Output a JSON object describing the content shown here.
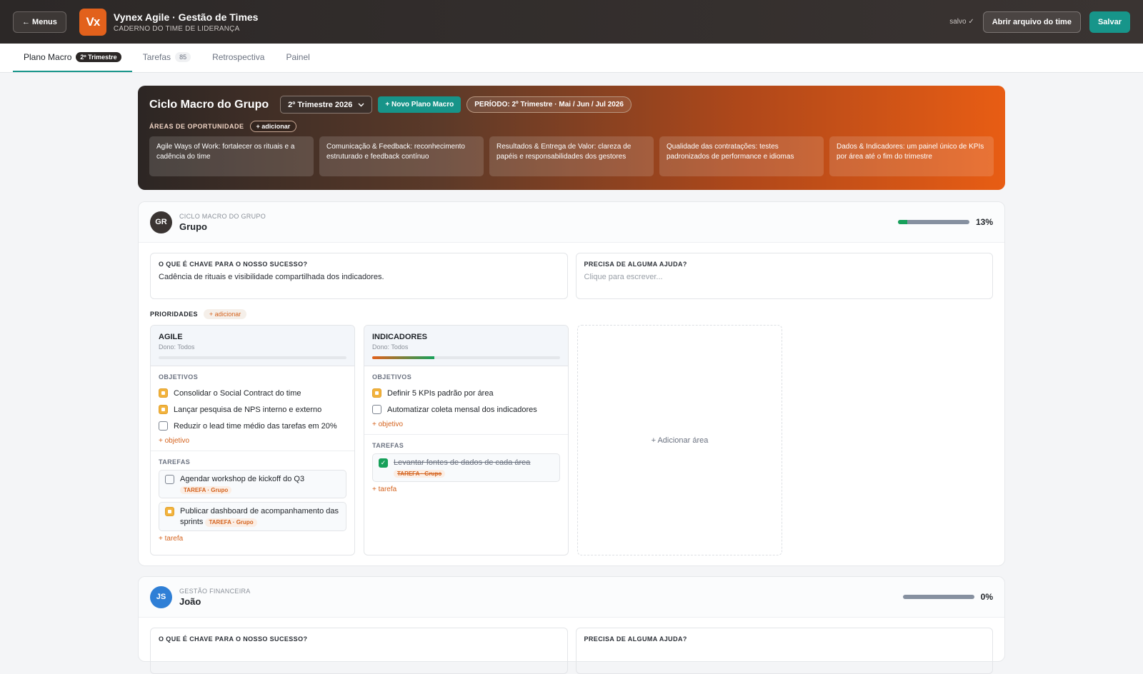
{
  "topbar": {
    "menus_label": "← Menus",
    "logo_text": "Vx",
    "title": "Vynex Agile · Gestão de Times",
    "subtitle": "CADERNO DO TIME DE LIDERANÇA",
    "saved_status": "salvo ✓",
    "open_label": "Abrir arquivo do time",
    "save_label": "Salvar"
  },
  "tabs": [
    {
      "label": "Plano Macro",
      "badge": "2º Trimestre"
    },
    {
      "label": "Tarefas",
      "badge": "85"
    },
    {
      "label": "Retrospectiva"
    },
    {
      "label": "Painel"
    }
  ],
  "hero": {
    "title": "Ciclo Macro do Grupo",
    "quarter_select": "2º Trimestre 2026",
    "new_plan": "+ Novo Plano Macro",
    "period": "PERÍODO: 2º Trimestre · Mai / Jun / Jul 2026",
    "opp_label": "ÁREAS DE OPORTUNIDADE",
    "opp_add": "+ adicionar",
    "opportunities": [
      "Agile Ways of Work: fortalecer os rituais e a cadência do time",
      "Comunicação & Feedback: reconhecimento estruturado e feedback contínuo",
      "Resultados & Entrega de Valor: clareza de papéis e responsabilidades dos gestores",
      "Qualidade das contratações: testes padronizados de performance e idiomas",
      "Dados & Indicadores: um painel único de KPIs por área até o fim do trimestre"
    ]
  },
  "sections": [
    {
      "initials": "GR",
      "avatar_color": "#3a3432",
      "kicker": "CICLO MACRO DO GRUPO",
      "name": "Grupo",
      "progress": 0.13,
      "progress_label": "13%",
      "key_label": "O QUE É CHAVE PARA O NOSSO SUCESSO?",
      "key_text": "Cadência de rituais e visibilidade compartilhada dos indicadores.",
      "help_label": "PRECISA DE ALGUMA AJUDA?",
      "help_placeholder": "Clique para escrever...",
      "prio_label": "PRIORIDADES",
      "prio_add": "+ adicionar",
      "add_area": "+ Adicionar área",
      "priorities": [
        {
          "title": "AGILE",
          "owner": "Dono: Todos",
          "progress": 0.0,
          "objectives_label": "OBJETIVOS",
          "objectives": [
            {
              "text": "Consolidar o Social Contract do time",
              "state": "partial"
            },
            {
              "text": "Lançar pesquisa de NPS interno e externo",
              "state": "partial"
            },
            {
              "text": "Reduzir o lead time médio das tarefas em 20%",
              "state": "open"
            }
          ],
          "add_objective": "+ objetivo",
          "tasks_label": "TAREFAS",
          "tasks": [
            {
              "text": "Agendar workshop de kickoff do Q3",
              "tag": "TAREFA · Grupo",
              "state": "open"
            },
            {
              "text": "Publicar dashboard de acompanhamento das sprints",
              "tag": "TAREFA · Grupo",
              "state": "partial"
            }
          ],
          "add_task": "+ tarefa"
        },
        {
          "title": "INDICADORES",
          "owner": "Dono: Todos",
          "progress": 0.33,
          "objectives_label": "OBJETIVOS",
          "objectives": [
            {
              "text": "Definir 5 KPIs padrão por área",
              "state": "partial"
            },
            {
              "text": "Automatizar coleta mensal dos indicadores",
              "state": "open"
            }
          ],
          "add_objective": "+ objetivo",
          "tasks_label": "TAREFAS",
          "tasks": [
            {
              "text": "Levantar fontes de dados de cada área",
              "tag": "TAREFA · Grupo",
              "state": "done"
            }
          ],
          "add_task": "+ tarefa"
        }
      ]
    },
    {
      "initials": "JS",
      "avatar_color": "#2f7fd6",
      "kicker": "GESTÃO FINANCEIRA",
      "name": "João",
      "progress": 0.0,
      "progress_label": "0%",
      "key_label": "O QUE É CHAVE PARA O NOSSO SUCESSO?",
      "help_label": "PRECISA DE ALGUMA AJUDA?"
    }
  ]
}
